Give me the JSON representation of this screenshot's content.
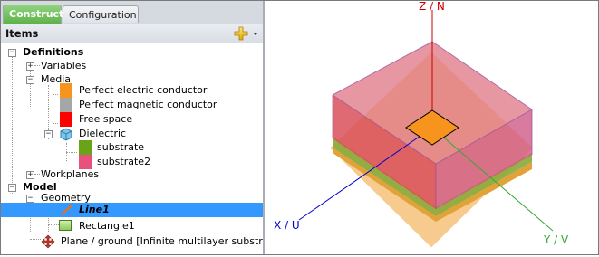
{
  "tabs": {
    "construct": "Construct",
    "configuration": "Configuration"
  },
  "panel": {
    "title": "Items"
  },
  "tree": {
    "definitions": "Definitions",
    "variables": "Variables",
    "media": "Media",
    "pec": "Perfect electric conductor",
    "pmc": "Perfect magnetic conductor",
    "free_space": "Free space",
    "dielectric": "Dielectric",
    "substrate": "substrate",
    "substrate2": "substrate2",
    "workplanes": "Workplanes",
    "model": "Model",
    "geometry": "Geometry",
    "line1": "Line1",
    "rectangle1": "Rectangle1",
    "plane_ground": "Plane / ground [Infinite multilayer substrate]"
  },
  "colors": {
    "pec": "#f7941d",
    "pmc": "#a6a6a6",
    "free_space": "#ff0000",
    "substrate": "#6aa318",
    "substrate2": "#e8517c",
    "selection": "#3399ff",
    "axis_z": "#cc0000",
    "axis_x": "#0000cc",
    "axis_y": "#33aa33"
  },
  "view3d": {
    "axis_z_label": "Z / N",
    "axis_x_label": "X / U",
    "axis_y_label": "Y / V"
  }
}
